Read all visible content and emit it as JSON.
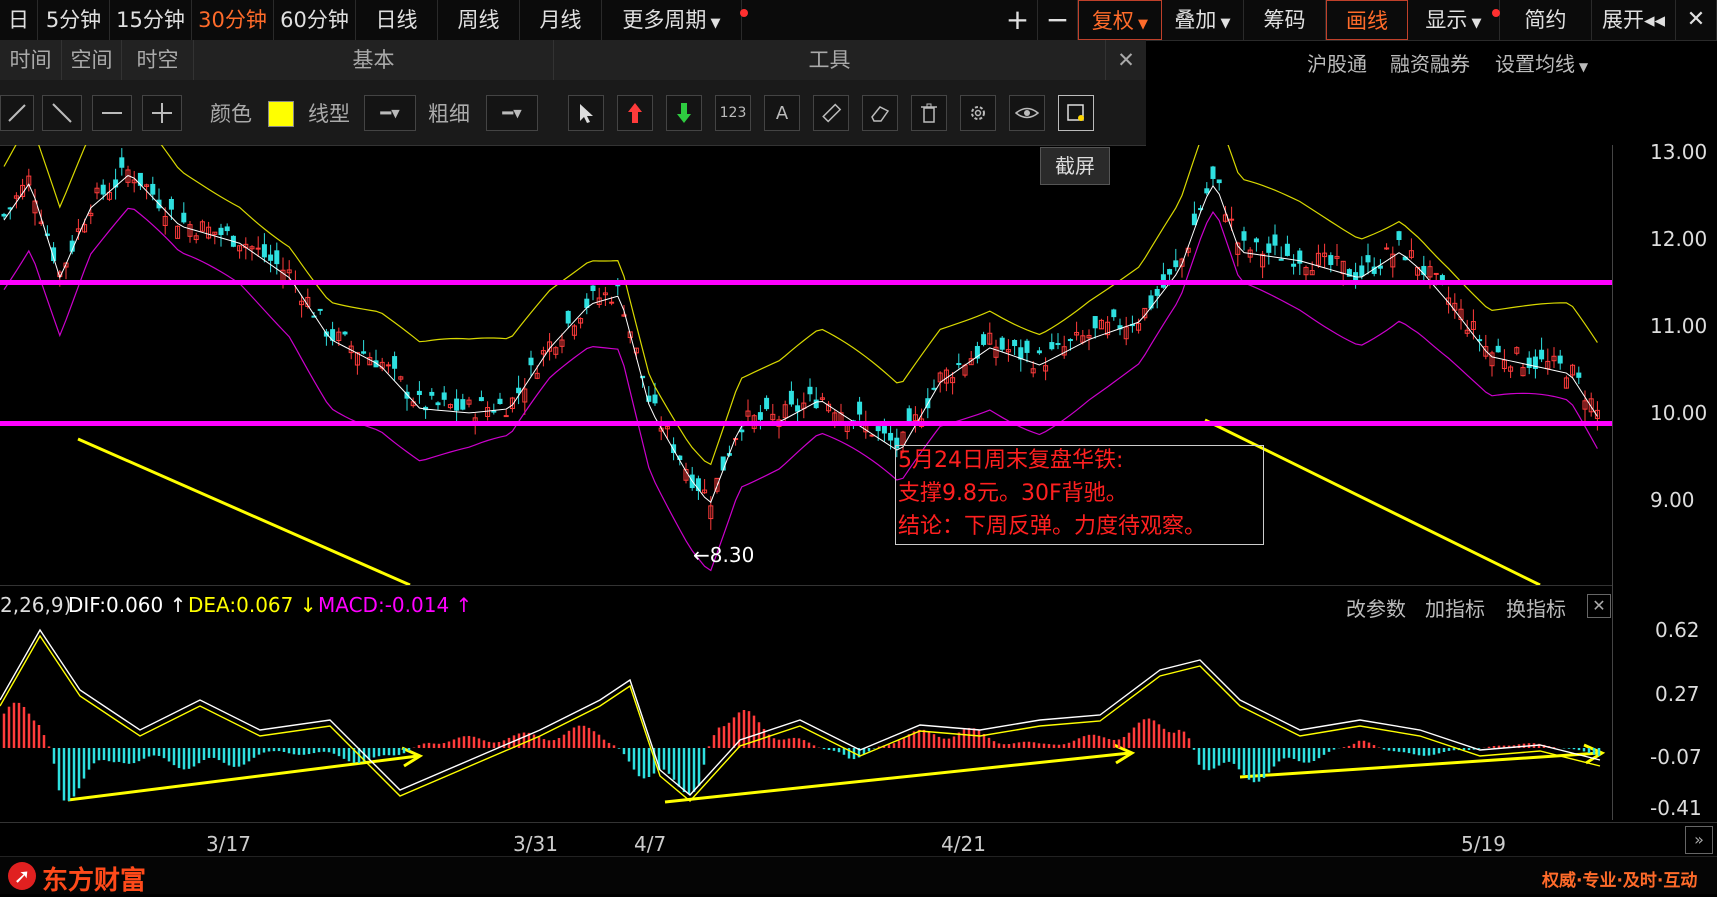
{
  "toolbar": {
    "items": [
      "日",
      "5分钟",
      "15分钟",
      "30分钟",
      "60分钟",
      "日线",
      "周线",
      "月线",
      "更多周期"
    ],
    "active": "30分钟",
    "right_items": [
      "复权",
      "叠加",
      "筹码",
      "画线",
      "显示",
      "简约",
      "展开"
    ],
    "plus_icon": "plus-icon",
    "minus_icon": "minus-icon",
    "close_icon": "close-x-icon"
  },
  "panel": {
    "tabs": [
      "时间",
      "空间",
      "时空",
      "基本",
      "工具"
    ],
    "color_label": "颜色",
    "color_value": "#ffff00",
    "line_type_label": "线型",
    "thickness_label": "粗细",
    "tool_icons": [
      "cursor-icon",
      "up-arrow-icon",
      "down-arrow-icon",
      "number-icon",
      "text-icon",
      "ruler-icon",
      "eraser-icon",
      "trash-icon",
      "gear-icon",
      "eye-icon",
      "screenshot-icon"
    ],
    "tooltip": "截屏",
    "number_text": "123",
    "text_tool": "A"
  },
  "right_links": [
    "沪股通",
    "融资融券",
    "设置均线"
  ],
  "price_axis": [
    "13.00",
    "12.00",
    "11.00",
    "10.00",
    "9.00"
  ],
  "low_label": "8.30",
  "annotation": {
    "line1": "5月24日周末复盘华铁:",
    "line2": "支撑9.8元。30F背驰。",
    "line3": "结论：下周反弹。力度待观察。"
  },
  "macd": {
    "params": "2,26,9)",
    "dif": "DIF:0.060",
    "dea": "DEA:0.067",
    "macd": "MACD:-0.014",
    "links": [
      "改参数",
      "加指标",
      "换指标"
    ],
    "axis": [
      "0.62",
      "0.27",
      "-0.07",
      "-0.41"
    ]
  },
  "dates": [
    "3/17",
    "3/31",
    "4/7",
    "4/21",
    "5/19"
  ],
  "footer": {
    "brand": "东方财富",
    "slogan": "权威·专业·及时·互动"
  },
  "colors": {
    "up": "#ff3b3b",
    "down": "#2ee0e0",
    "magenta": "#ff00ff",
    "yellow": "#ffff00",
    "active": "#ff6b2a"
  }
}
